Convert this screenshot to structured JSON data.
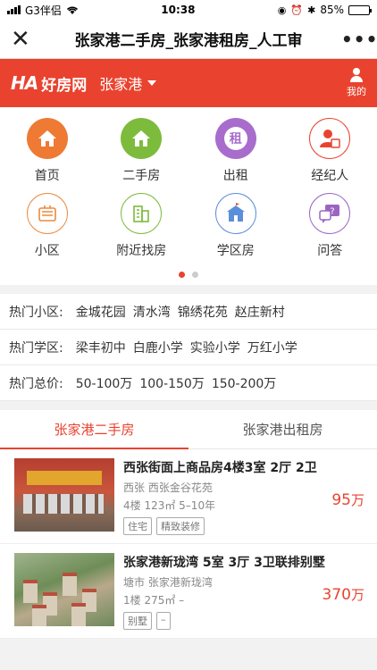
{
  "status": {
    "carrier": "G3伴侣",
    "time": "10:38",
    "battery": "85%",
    "battery_level": 0.85
  },
  "nav": {
    "close": "✕",
    "title": "张家港二手房_张家港租房_人工审",
    "more": "•••"
  },
  "brand": {
    "logo_mark": "HA",
    "logo_text": "好房网",
    "city": "张家港",
    "mine": "我的"
  },
  "grid": {
    "row1": [
      {
        "label": "首页",
        "icon": "home-icon"
      },
      {
        "label": "二手房",
        "icon": "house-icon"
      },
      {
        "label": "出租",
        "icon": "rent-icon",
        "glyph": "租"
      },
      {
        "label": "经纪人",
        "icon": "agent-icon"
      }
    ],
    "row2": [
      {
        "label": "小区",
        "icon": "community-icon"
      },
      {
        "label": "附近找房",
        "icon": "nearby-building-icon"
      },
      {
        "label": "学区房",
        "icon": "school-icon"
      },
      {
        "label": "问答",
        "icon": "qa-icon"
      }
    ],
    "page_count": 2,
    "active_page": 1
  },
  "hot": {
    "community": {
      "label": "热门小区:",
      "items": [
        "金城花园",
        "清水湾",
        "锦绣花苑",
        "赵庄新村"
      ]
    },
    "school": {
      "label": "热门学区:",
      "items": [
        "梁丰初中",
        "白鹿小学",
        "实验小学",
        "万红小学"
      ]
    },
    "price": {
      "label": "热门总价:",
      "items": [
        "50-100万",
        "100-150万",
        "150-200万"
      ]
    }
  },
  "tabs": [
    "张家港二手房",
    "张家港出租房"
  ],
  "listings": [
    {
      "title": "西张街面上商品房4楼3室 2厅 2卫",
      "location": "西张  西张金谷花苑",
      "meta": "4楼   123㎡   5–10年",
      "tags": [
        "住宅",
        "精致装修"
      ],
      "price": "95",
      "unit": "万"
    },
    {
      "title": "张家港新珑湾 5室 3厅 3卫联排别墅",
      "location": "塘市  张家港新珑湾",
      "meta": "1楼   275㎡   –",
      "tags": [
        "别墅",
        "–"
      ],
      "price": "370",
      "unit": "万"
    }
  ],
  "colors": {
    "brand": "#e9432f",
    "orange": "#ee7a34",
    "green": "#7dbb3d",
    "purple": "#a86ccd",
    "blue": "#5b8fd9"
  }
}
